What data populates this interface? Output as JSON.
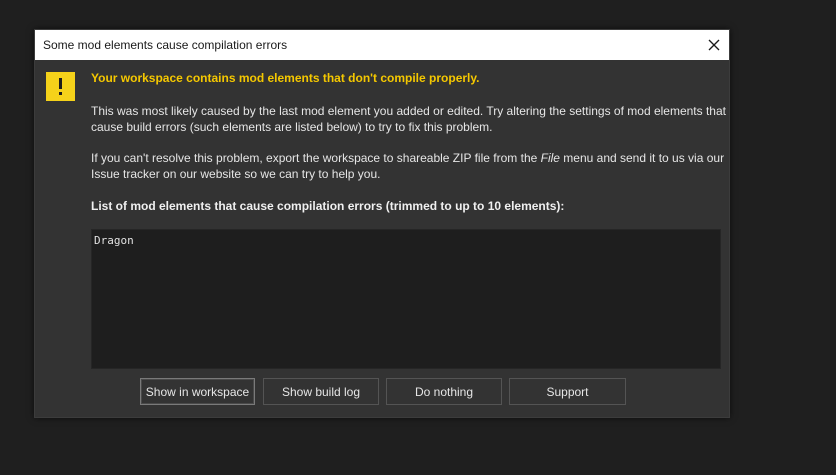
{
  "dialog": {
    "title": "Some mod elements cause compilation errors",
    "close_icon": "close-icon",
    "warning_icon": "warning-exclamation-icon",
    "headline": "Your workspace contains mod elements that don't compile properly.",
    "paragraph1": "This was most likely caused by the last mod element you added or edited. Try altering the settings of mod elements that cause build errors (such elements are listed below) to try to fix this problem.",
    "paragraph2_before": "If you can't resolve this problem, export the workspace to shareable ZIP file from the ",
    "paragraph2_emph": "File",
    "paragraph2_after": " menu and send it to us via our Issue tracker on our website so we can try to help you.",
    "list_title": "List of mod elements that cause compilation errors (trimmed to up to 10 elements):",
    "list_items": [
      "Dragon"
    ],
    "buttons": {
      "show_workspace": "Show in workspace",
      "show_build_log": "Show build log",
      "do_nothing": "Do nothing",
      "support": "Support"
    }
  },
  "colors": {
    "background": "#1f1f1f",
    "dialog_bg": "#333333",
    "titlebar_bg": "#ffffff",
    "headline": "#f5c800",
    "warning_icon": "#f5d21a",
    "list_bg": "#1e1e1e"
  }
}
